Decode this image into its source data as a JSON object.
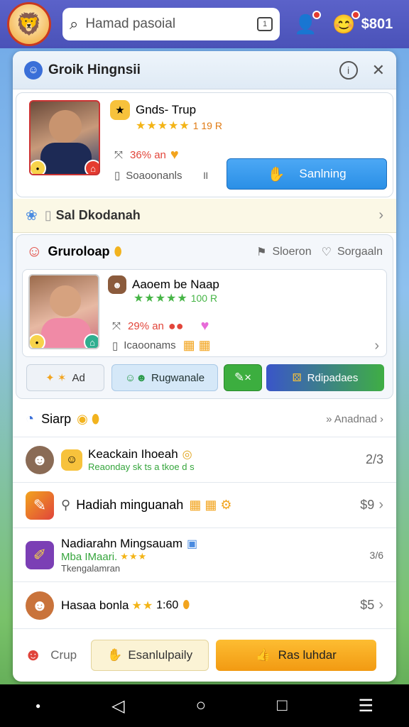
{
  "topbar": {
    "search_text": "Hamad pasoial",
    "coins": "$801"
  },
  "panel": {
    "title": "Groik Hingnsii",
    "profile1": {
      "name": "Gnds- Trup",
      "rating": "1 19 R",
      "percent": "36% an",
      "meta": "Soaoonanls",
      "action": "Sanlning"
    },
    "banner": "Sal Dkodanah",
    "group": {
      "title": "Gruroloap",
      "action1": "Sloeron",
      "action2": "Sorgaaln",
      "name": "Aaoem be Naap",
      "rating": "100 R",
      "percent": "29% an",
      "meta": "Icaoonams",
      "btn1": "Ad",
      "btn2": "Rugwanale",
      "btn4": "Rdipadaes"
    },
    "list_header": {
      "title": "Siarp",
      "right": "Anadnad"
    },
    "list": [
      {
        "title": "Keackain Ihoeah",
        "subtitle": "Reaonday sk ts a tkoe d s",
        "price": "2/3"
      },
      {
        "title": "Hadiah minguanah",
        "price": "$9"
      },
      {
        "title": "Nadiarahn Mingsauam",
        "subtitle": "Mba IMaari.",
        "sub2": "Tkengalamran",
        "price": "3/6"
      },
      {
        "title": "Hasaa bonla",
        "rating": "1:60",
        "price": "$5"
      }
    ],
    "footer": {
      "label": "Crup",
      "btn1": "Esanlulpaily",
      "btn2": "Ras luhdar"
    }
  },
  "colors": {
    "accent": "#2a8fe6",
    "orange": "#f5a81c",
    "purple": "#4a52b8",
    "green": "#35a53c"
  }
}
